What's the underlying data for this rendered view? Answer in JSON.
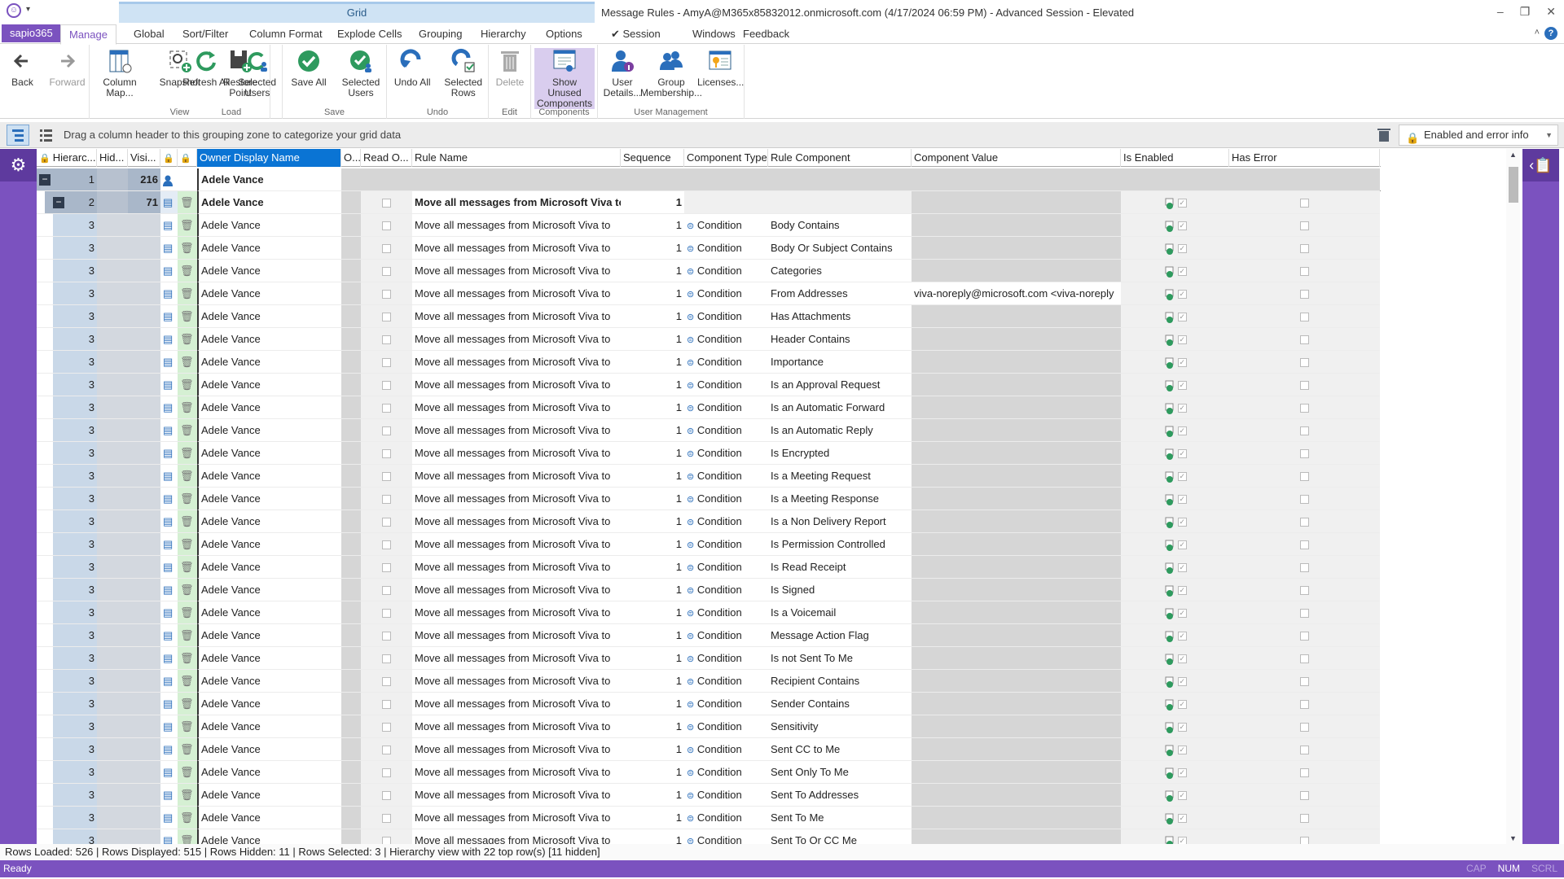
{
  "window": {
    "title": "Message Rules - AmyA@M365x85832012.onmicrosoft.com (4/17/2024 06:59 PM) - Advanced Session - Elevated",
    "context_tab": "Grid"
  },
  "tabs": [
    "sapio365",
    "Manage",
    "Global",
    "Sort/Filter",
    "Column Format",
    "Explode Cells",
    "Grouping",
    "Hierarchy",
    "Options",
    "✔ Session",
    "Windows",
    "Feedback"
  ],
  "active_tab": "Manage",
  "ribbon": {
    "groups": [
      {
        "label": "",
        "buttons": [
          {
            "label": "Back",
            "icon": "arrow-left-icon"
          },
          {
            "label": "Forward",
            "icon": "arrow-right-icon",
            "disabled": true
          }
        ]
      },
      {
        "label": "View",
        "buttons": [
          {
            "label": "Column Map...",
            "icon": "column-map-icon"
          },
          {
            "label": "Snapshot",
            "icon": "snapshot-icon"
          },
          {
            "label": "Restore Point",
            "icon": "restore-point-icon"
          }
        ]
      },
      {
        "label": "Load",
        "buttons": [
          {
            "label": "Refresh All",
            "icon": "refresh-icon"
          },
          {
            "label": "Selected Users",
            "icon": "refresh-users-icon"
          }
        ]
      },
      {
        "label": "Save",
        "buttons": [
          {
            "label": "Save All",
            "icon": "check-icon"
          },
          {
            "label": "Selected Users",
            "icon": "check-users-icon"
          }
        ]
      },
      {
        "label": "Undo",
        "buttons": [
          {
            "label": "Undo All",
            "icon": "undo-icon"
          },
          {
            "label": "Selected Rows",
            "icon": "undo-rows-icon"
          }
        ]
      },
      {
        "label": "Edit",
        "buttons": [
          {
            "label": "Delete",
            "icon": "trash-icon",
            "disabled": true
          }
        ]
      },
      {
        "label": "Components",
        "buttons": [
          {
            "label": "Show Unused Components",
            "icon": "components-icon",
            "selected": true
          }
        ]
      },
      {
        "label": "User Management",
        "buttons": [
          {
            "label": "User Details...",
            "icon": "user-info-icon"
          },
          {
            "label": "Group Membership...",
            "icon": "group-icon"
          },
          {
            "label": "Licenses...",
            "icon": "license-icon"
          }
        ]
      }
    ]
  },
  "grouping_hint": "Drag a column header to this grouping zone to categorize your grid data",
  "preset": "Enabled and error info",
  "columns": [
    "Hierarc...",
    "Hid...",
    "Visi...",
    "",
    "",
    "Owner Display Name",
    "O...",
    "Read O...",
    "Rule Name",
    "Sequence",
    "Component Type",
    "Rule Component",
    "Component Value",
    "Is Enabled",
    "Has Error"
  ],
  "level1": {
    "hierarchy": "1",
    "visible": "216",
    "owner": "Adele Vance"
  },
  "level2": {
    "hierarchy": "2",
    "visible": "71",
    "owner": "Adele Vance",
    "rule_name": "Move all messages from Microsoft Viva to",
    "sequence": "1"
  },
  "rows_common": {
    "hierarchy": "3",
    "owner": "Adele Vance",
    "rule_name": "Move all messages from Microsoft Viva to",
    "sequence": "1",
    "component_type": "Condition"
  },
  "rows": [
    {
      "component": "Body Contains",
      "value": ""
    },
    {
      "component": "Body Or Subject Contains",
      "value": ""
    },
    {
      "component": "Categories",
      "value": ""
    },
    {
      "component": "From Addresses",
      "value": "viva-noreply@microsoft.com <viva-noreply"
    },
    {
      "component": "Has Attachments",
      "value": ""
    },
    {
      "component": "Header Contains",
      "value": ""
    },
    {
      "component": "Importance",
      "value": ""
    },
    {
      "component": "Is an Approval Request",
      "value": ""
    },
    {
      "component": "Is an Automatic Forward",
      "value": ""
    },
    {
      "component": "Is an Automatic Reply",
      "value": ""
    },
    {
      "component": "Is Encrypted",
      "value": ""
    },
    {
      "component": "Is a Meeting Request",
      "value": ""
    },
    {
      "component": "Is a Meeting Response",
      "value": ""
    },
    {
      "component": "Is a Non Delivery Report",
      "value": ""
    },
    {
      "component": "Is Permission Controlled",
      "value": ""
    },
    {
      "component": "Is Read Receipt",
      "value": ""
    },
    {
      "component": "Is Signed",
      "value": ""
    },
    {
      "component": "Is a Voicemail",
      "value": ""
    },
    {
      "component": "Message Action Flag",
      "value": ""
    },
    {
      "component": "Is not Sent To Me",
      "value": ""
    },
    {
      "component": "Recipient Contains",
      "value": ""
    },
    {
      "component": "Sender Contains",
      "value": ""
    },
    {
      "component": "Sensitivity",
      "value": ""
    },
    {
      "component": "Sent CC to Me",
      "value": ""
    },
    {
      "component": "Sent Only To Me",
      "value": ""
    },
    {
      "component": "Sent To Addresses",
      "value": ""
    },
    {
      "component": "Sent To Me",
      "value": ""
    },
    {
      "component": "Sent To Or CC Me",
      "value": ""
    }
  ],
  "summary": "Rows Loaded: 526 | Rows Displayed: 515 | Rows Hidden: 11 | Rows Selected: 3 | Hierarchy view with 22 top row(s) [11 hidden]",
  "status": {
    "text": "Ready",
    "keys": [
      "CAP",
      "NUM",
      "SCRL"
    ],
    "active_key": "NUM"
  },
  "colors": {
    "accent": "#7b52bf",
    "selected_header": "#0a74d4",
    "context_tab": "#cfe3f4"
  }
}
